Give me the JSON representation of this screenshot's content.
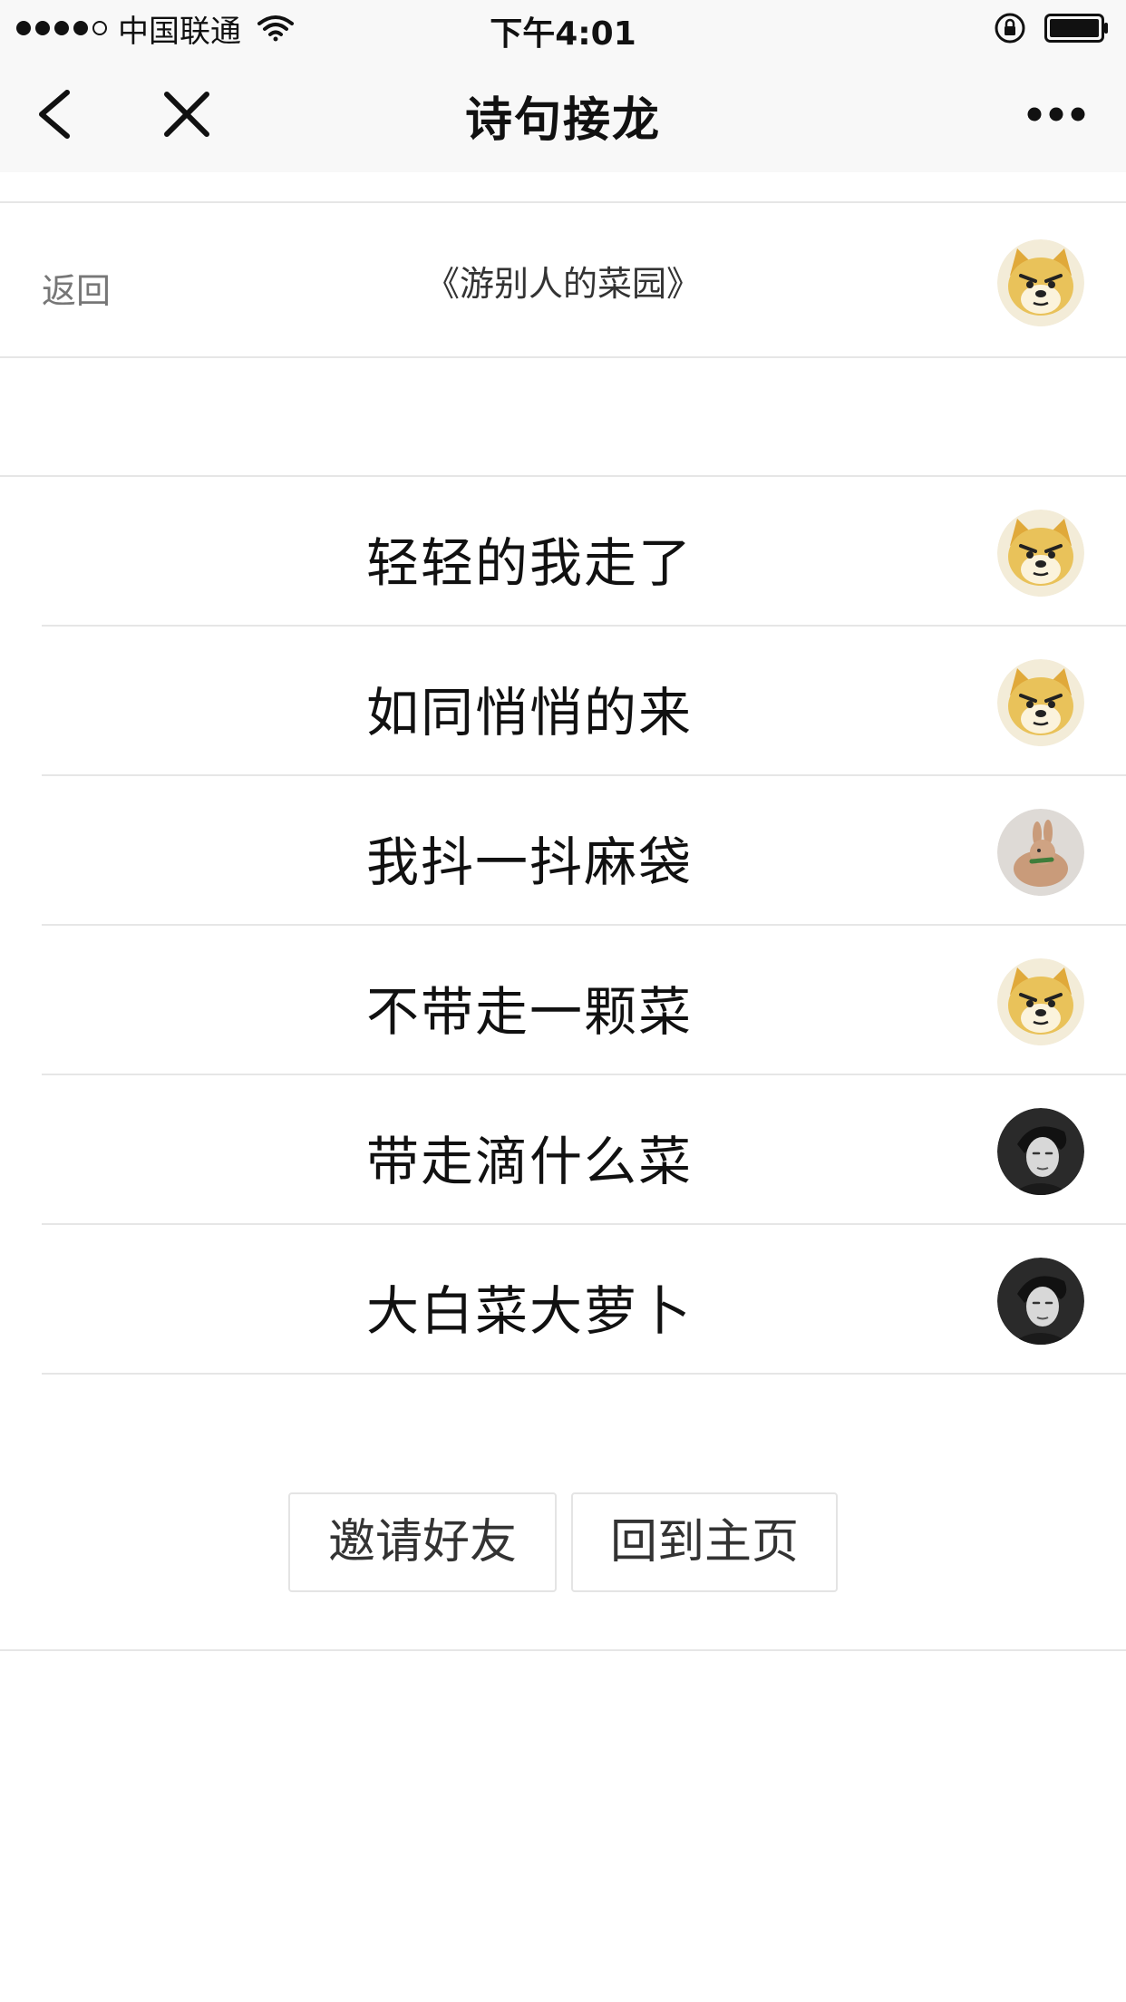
{
  "status_bar": {
    "carrier": "中国联通",
    "time": "下午4:01",
    "signal_strength": 4,
    "icons": [
      "wifi-icon",
      "rotation-lock-icon",
      "battery-icon"
    ]
  },
  "nav": {
    "title": "诗句接龙",
    "icons": [
      "back-chevron-icon",
      "close-icon",
      "more-dots-icon"
    ]
  },
  "header": {
    "back_label": "返回",
    "poem_title": "《游别人的菜园》",
    "avatar": "doge-avatar"
  },
  "lines": [
    {
      "text": "轻轻的我走了",
      "avatar": "doge-avatar"
    },
    {
      "text": "如同悄悄的来",
      "avatar": "doge-avatar"
    },
    {
      "text": "我抖一抖麻袋",
      "avatar": "rabbit-avatar"
    },
    {
      "text": "不带走一颗菜",
      "avatar": "doge-avatar"
    },
    {
      "text": "带走滴什么菜",
      "avatar": "portrait-avatar"
    },
    {
      "text": "大白菜大萝卜",
      "avatar": "portrait-avatar"
    }
  ],
  "buttons": {
    "invite_label": "邀请好友",
    "home_label": "回到主页"
  },
  "colors": {
    "bar_background": "#f8f8f8",
    "divider": "#e6e6e6",
    "doge_yellow": "#e9c25a"
  }
}
